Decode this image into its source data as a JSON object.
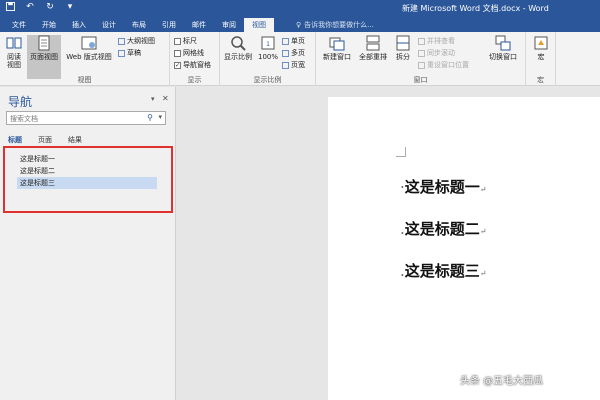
{
  "window": {
    "title": "新建 Microsoft Word 文档.docx - Word",
    "qat": {
      "save_icon": "save-icon",
      "undo_icon": "undo-icon",
      "redo_icon": "redo-icon"
    }
  },
  "tabs": [
    {
      "label": "文件"
    },
    {
      "label": "开始"
    },
    {
      "label": "插入"
    },
    {
      "label": "设计"
    },
    {
      "label": "布局"
    },
    {
      "label": "引用"
    },
    {
      "label": "邮件"
    },
    {
      "label": "审阅"
    },
    {
      "label": "视图",
      "active": true
    }
  ],
  "tell_me": {
    "placeholder": "告诉我你想要做什么..."
  },
  "ribbon": {
    "views": {
      "read_mode": "阅读\n视图",
      "print_layout": "页面视图",
      "web_layout": "Web 版式视图",
      "outline": "大纲视图",
      "draft": "草稿",
      "group_label": "视图"
    },
    "show": {
      "ruler": "标尺",
      "gridlines": "网格线",
      "nav_pane": "导航窗格",
      "group_label": "显示"
    },
    "zoom": {
      "zoom": "显示比例",
      "hundred": "100%",
      "one_page": "单页",
      "multi_page": "多页",
      "page_width": "页宽",
      "group_label": "显示比例"
    },
    "window": {
      "new_window": "新建窗口",
      "arrange_all": "全部重排",
      "split": "拆分",
      "side_by_side": "并排查看",
      "sync_scroll": "同步滚动",
      "reset_position": "重设窗口位置",
      "switch_windows": "切换窗口",
      "group_label": "窗口"
    },
    "macros": {
      "macros": "宏",
      "group_label": "宏"
    }
  },
  "nav_pane": {
    "title": "导航",
    "search_placeholder": "搜索文档",
    "tabs": [
      {
        "label": "标题",
        "active": true
      },
      {
        "label": "页面"
      },
      {
        "label": "结果"
      }
    ],
    "headings": [
      {
        "label": "这是标题一"
      },
      {
        "label": "这是标题二"
      },
      {
        "label": "这是标题三",
        "selected": true
      }
    ]
  },
  "document": {
    "headings": [
      "这是标题一",
      "这是标题二",
      "这是标题三"
    ]
  },
  "watermark": "头条 @五毛大西瓜",
  "colors": {
    "accent": "#2b579a",
    "highlight": "#c8daf2",
    "annotation": "#e0302f"
  }
}
